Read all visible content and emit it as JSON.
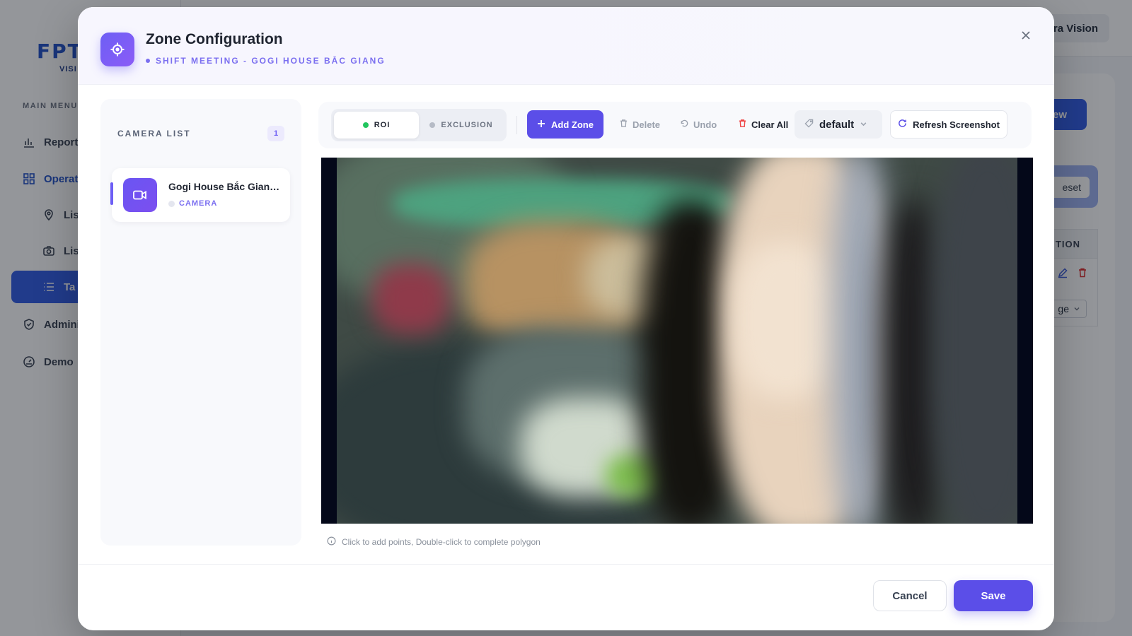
{
  "background": {
    "logo": "FPT",
    "logo_sub": "VISI",
    "menu_label": "MAIN MENU",
    "nav": [
      {
        "label": "Reports",
        "icon": "bar-chart-icon"
      },
      {
        "label": "Operat",
        "icon": "grid-icon"
      },
      {
        "label": "Lis",
        "icon": "map-pin-icon"
      },
      {
        "label": "Lis",
        "icon": "camera-icon"
      },
      {
        "label": "Ta",
        "icon": "list-icon"
      },
      {
        "label": "Admini",
        "icon": "shield-icon"
      },
      {
        "label": "Demo",
        "icon": "gauge-icon"
      }
    ],
    "top_chip": "era Vision",
    "new_button": "ew",
    "reset_button": "eset",
    "table_header": "TION",
    "row_select": "ge"
  },
  "modal": {
    "title": "Zone Configuration",
    "subtitle": "SHIFT MEETING - GOGI HOUSE BẮC GIANG",
    "close_icon": "close-icon"
  },
  "camera_list": {
    "title": "CAMERA LIST",
    "count": "1",
    "items": [
      {
        "name": "Gogi House Bắc Giang...",
        "type": "CAMERA"
      }
    ]
  },
  "toolbar": {
    "modes": [
      {
        "label": "ROI",
        "active": true,
        "dot_color": "#22c55e"
      },
      {
        "label": "EXCLUSION",
        "active": false,
        "dot_color": "#b6bbc6"
      }
    ],
    "add_zone": "Add Zone",
    "delete": "Delete",
    "undo": "Undo",
    "clear_all": "Clear All",
    "zone_selected": "default",
    "refresh": "Refresh Screenshot"
  },
  "hint": "Click to add points, Double-click to complete polygon",
  "footer": {
    "cancel": "Cancel",
    "save": "Save"
  },
  "colors": {
    "accent": "#5b4ee8",
    "accent_light": "#7b6ff0",
    "danger": "#ef4444",
    "active_dot": "#22c55e"
  }
}
